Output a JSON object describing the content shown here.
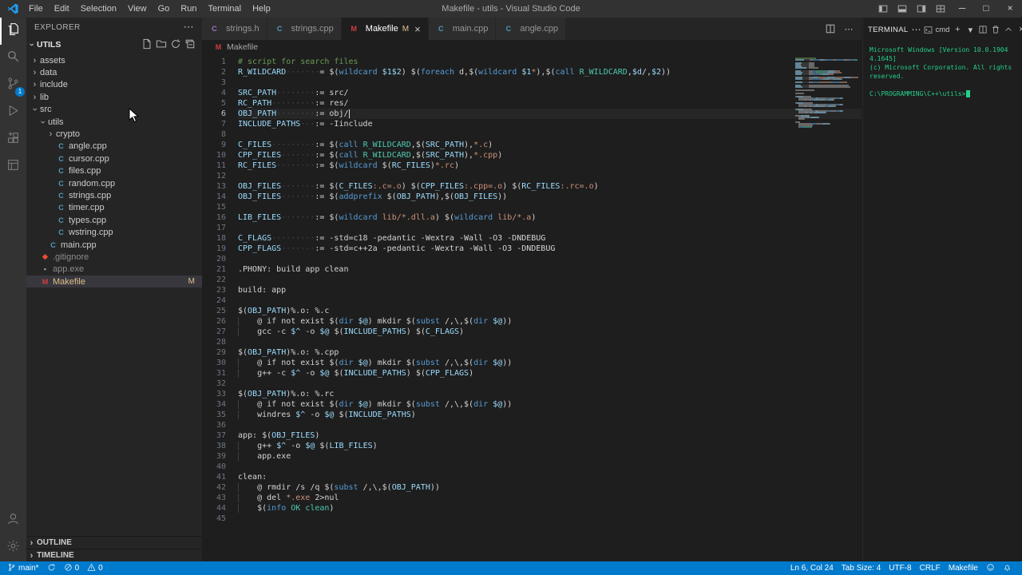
{
  "window": {
    "title": "Makefile - utils - Visual Studio Code",
    "menus": [
      "File",
      "Edit",
      "Selection",
      "View",
      "Go",
      "Run",
      "Terminal",
      "Help"
    ],
    "layout_icons": [
      "layout-sidebar",
      "layout-panel",
      "layout-sidebar-right",
      "layout-customize"
    ],
    "controls": {
      "minimize": "─",
      "maximize": "□",
      "close": "×"
    }
  },
  "activity_bar": {
    "items": [
      {
        "name": "explorer",
        "active": true
      },
      {
        "name": "search"
      },
      {
        "name": "source-control",
        "badge": "1"
      },
      {
        "name": "run-debug"
      },
      {
        "name": "extensions"
      },
      {
        "name": "remote-window"
      }
    ],
    "bottom": [
      {
        "name": "account"
      },
      {
        "name": "settings"
      }
    ]
  },
  "sidebar": {
    "header": "EXPLORER",
    "more": "⋯",
    "section": "UTILS",
    "section_actions": [
      "new-file",
      "new-folder",
      "refresh",
      "collapse-all"
    ],
    "tree": [
      {
        "label": "assets",
        "level": 0,
        "kind": "folder"
      },
      {
        "label": "data",
        "level": 0,
        "kind": "folder"
      },
      {
        "label": "include",
        "level": 0,
        "kind": "folder"
      },
      {
        "label": "lib",
        "level": 0,
        "kind": "folder"
      },
      {
        "label": "src",
        "level": 0,
        "kind": "folder",
        "expanded": true
      },
      {
        "label": "utils",
        "level": 1,
        "kind": "folder",
        "expanded": true
      },
      {
        "label": "crypto",
        "level": 2,
        "kind": "folder"
      },
      {
        "label": "angle.cpp",
        "level": 2,
        "kind": "file",
        "icon": "cpp"
      },
      {
        "label": "cursor.cpp",
        "level": 2,
        "kind": "file",
        "icon": "cpp"
      },
      {
        "label": "files.cpp",
        "level": 2,
        "kind": "file",
        "icon": "cpp"
      },
      {
        "label": "random.cpp",
        "level": 2,
        "kind": "file",
        "icon": "cpp"
      },
      {
        "label": "strings.cpp",
        "level": 2,
        "kind": "file",
        "icon": "cpp"
      },
      {
        "label": "timer.cpp",
        "level": 2,
        "kind": "file",
        "icon": "cpp"
      },
      {
        "label": "types.cpp",
        "level": 2,
        "kind": "file",
        "icon": "cpp"
      },
      {
        "label": "wstring.cpp",
        "level": 2,
        "kind": "file",
        "icon": "cpp"
      },
      {
        "label": "main.cpp",
        "level": 1,
        "kind": "file",
        "icon": "cpp"
      },
      {
        "label": ".gitignore",
        "level": 0,
        "kind": "file",
        "icon": "git",
        "dim": true
      },
      {
        "label": "app.exe",
        "level": 0,
        "kind": "file",
        "icon": "exe",
        "dim": true
      },
      {
        "label": "Makefile",
        "level": 0,
        "kind": "file",
        "icon": "make",
        "selected": true,
        "modified": true,
        "badge": "M"
      }
    ],
    "bottom_sections": [
      {
        "label": "OUTLINE"
      },
      {
        "label": "TIMELINE"
      }
    ]
  },
  "file_icons": {
    "cpp": {
      "glyph": "C",
      "color": "#519aba"
    },
    "h": {
      "glyph": "C",
      "color": "#a074c4"
    },
    "git": {
      "glyph": "◆",
      "color": "#e84d31"
    },
    "exe": {
      "glyph": "▪",
      "color": "#9e9e9e"
    },
    "make": {
      "glyph": "M",
      "color": "#cc3e44"
    }
  },
  "editor": {
    "tabs": [
      {
        "label": "strings.h",
        "icon": "h"
      },
      {
        "label": "strings.cpp",
        "icon": "cpp"
      },
      {
        "label": "Makefile",
        "icon": "make",
        "active": true,
        "badge": "M",
        "close": "×"
      },
      {
        "label": "main.cpp",
        "icon": "cpp"
      },
      {
        "label": "angle.cpp",
        "icon": "cpp"
      }
    ],
    "tab_actions": [
      "split-editor",
      "more"
    ],
    "breadcrumb": {
      "icon": "make",
      "label": "Makefile"
    },
    "cursor": {
      "line": 6,
      "col": 24
    },
    "lines": [
      [
        [
          "cm",
          "# script for search files"
        ]
      ],
      [
        [
          "vr",
          "R_WILDCARD"
        ],
        [
          "ws",
          "·······"
        ],
        [
          "pl",
          "= $("
        ],
        [
          "fn",
          "wildcard"
        ],
        [
          "pl",
          " "
        ],
        [
          "vr",
          "$1$2"
        ],
        [
          "pl",
          ") $("
        ],
        [
          "fn",
          "foreach"
        ],
        [
          "pl",
          " d,$("
        ],
        [
          "fn",
          "wildcard"
        ],
        [
          "pl",
          " "
        ],
        [
          "vr",
          "$1"
        ],
        [
          "st",
          "*"
        ],
        [
          "pl",
          "),$("
        ],
        [
          "fn",
          "call"
        ],
        [
          "pl",
          " "
        ],
        [
          "tl",
          "R_WILDCARD"
        ],
        [
          "pl",
          ","
        ],
        [
          "vr",
          "$d"
        ],
        [
          "pl",
          "/,"
        ],
        [
          "vr",
          "$2"
        ],
        [
          "pl",
          "))"
        ]
      ],
      [],
      [
        [
          "vr",
          "SRC_PATH"
        ],
        [
          "ws",
          "········"
        ],
        [
          "pl",
          ":= src/"
        ]
      ],
      [
        [
          "vr",
          "RC_PATH"
        ],
        [
          "ws",
          "·········"
        ],
        [
          "pl",
          ":= res/"
        ]
      ],
      [
        [
          "vr",
          "OBJ_PATH"
        ],
        [
          "ws",
          "········"
        ],
        [
          "pl",
          ":= obj/"
        ],
        [
          "cur",
          ""
        ]
      ],
      [
        [
          "vr",
          "INCLUDE_PATHS"
        ],
        [
          "ws",
          "···"
        ],
        [
          "pl",
          ":= -Iinclude"
        ]
      ],
      [],
      [
        [
          "vr",
          "C_FILES"
        ],
        [
          "ws",
          "·········"
        ],
        [
          "pl",
          ":= $("
        ],
        [
          "fn",
          "call"
        ],
        [
          "pl",
          " "
        ],
        [
          "tl",
          "R_WILDCARD"
        ],
        [
          "pl",
          ",$("
        ],
        [
          "vr",
          "SRC_PATH"
        ],
        [
          "pl",
          "),"
        ],
        [
          "st",
          "*.c"
        ],
        [
          "pl",
          ")"
        ]
      ],
      [
        [
          "vr",
          "CPP_FILES"
        ],
        [
          "ws",
          "·······"
        ],
        [
          "pl",
          ":= $("
        ],
        [
          "fn",
          "call"
        ],
        [
          "pl",
          " "
        ],
        [
          "tl",
          "R_WILDCARD"
        ],
        [
          "pl",
          ",$("
        ],
        [
          "vr",
          "SRC_PATH"
        ],
        [
          "pl",
          "),"
        ],
        [
          "st",
          "*.cpp"
        ],
        [
          "pl",
          ")"
        ]
      ],
      [
        [
          "vr",
          "RC_FILES"
        ],
        [
          "ws",
          "········"
        ],
        [
          "pl",
          ":= $("
        ],
        [
          "fn",
          "wildcard"
        ],
        [
          "pl",
          " $("
        ],
        [
          "vr",
          "RC_FILES"
        ],
        [
          "pl",
          ")"
        ],
        [
          "st",
          "*.rc"
        ],
        [
          "pl",
          ")"
        ]
      ],
      [],
      [
        [
          "vr",
          "OBJ_FILES"
        ],
        [
          "ws",
          "·······"
        ],
        [
          "pl",
          ":= $("
        ],
        [
          "vr",
          "C_FILES"
        ],
        [
          "st",
          ":.c=.o"
        ],
        [
          "pl",
          ") $("
        ],
        [
          "vr",
          "CPP_FILES"
        ],
        [
          "st",
          ":.cpp=.o"
        ],
        [
          "pl",
          ") $("
        ],
        [
          "vr",
          "RC_FILES"
        ],
        [
          "st",
          ":.rc=.o"
        ],
        [
          "pl",
          ")"
        ]
      ],
      [
        [
          "vr",
          "OBJ_FILES"
        ],
        [
          "ws",
          "·······"
        ],
        [
          "pl",
          ":= $("
        ],
        [
          "fn",
          "addprefix"
        ],
        [
          "pl",
          " $("
        ],
        [
          "vr",
          "OBJ_PATH"
        ],
        [
          "pl",
          "),$("
        ],
        [
          "vr",
          "OBJ_FILES"
        ],
        [
          "pl",
          "))"
        ]
      ],
      [],
      [
        [
          "vr",
          "LIB_FILES"
        ],
        [
          "ws",
          "·······"
        ],
        [
          "pl",
          ":= $("
        ],
        [
          "fn",
          "wildcard"
        ],
        [
          "pl",
          " "
        ],
        [
          "st",
          "lib/*.dll.a"
        ],
        [
          "pl",
          ") $("
        ],
        [
          "fn",
          "wildcard"
        ],
        [
          "pl",
          " "
        ],
        [
          "st",
          "lib/*.a"
        ],
        [
          "pl",
          ")"
        ]
      ],
      [],
      [
        [
          "vr",
          "C_FLAGS"
        ],
        [
          "ws",
          "·········"
        ],
        [
          "pl",
          ":= -std=c18 -pedantic -Wextra -Wall -O3 -DNDEBUG"
        ]
      ],
      [
        [
          "vr",
          "CPP_FLAGS"
        ],
        [
          "ws",
          "·······"
        ],
        [
          "pl",
          ":= -std=c++2a -pedantic -Wextra -Wall -O3 -DNDEBUG"
        ]
      ],
      [],
      [
        [
          "pl",
          ".PHONY: build app clean"
        ]
      ],
      [],
      [
        [
          "pl",
          "build: app"
        ]
      ],
      [],
      [
        [
          "pl",
          "$("
        ],
        [
          "vr",
          "OBJ_PATH"
        ],
        [
          "pl",
          ")%.o: %.c"
        ]
      ],
      [
        [
          "ig",
          "    "
        ],
        [
          "pl",
          "@ if not exist $("
        ],
        [
          "fn",
          "dir"
        ],
        [
          "pl",
          " "
        ],
        [
          "vr",
          "$@"
        ],
        [
          "pl",
          ") mkdir $("
        ],
        [
          "fn",
          "subst"
        ],
        [
          "pl",
          " /,\\,$("
        ],
        [
          "fn",
          "dir"
        ],
        [
          "pl",
          " "
        ],
        [
          "vr",
          "$@"
        ],
        [
          "pl",
          "))"
        ]
      ],
      [
        [
          "ig",
          "    "
        ],
        [
          "pl",
          "gcc -c "
        ],
        [
          "vr",
          "$^"
        ],
        [
          "pl",
          " -o "
        ],
        [
          "vr",
          "$@"
        ],
        [
          "pl",
          " $("
        ],
        [
          "vr",
          "INCLUDE_PATHS"
        ],
        [
          "pl",
          ") $("
        ],
        [
          "vr",
          "C_FLAGS"
        ],
        [
          "pl",
          ")"
        ]
      ],
      [],
      [
        [
          "pl",
          "$("
        ],
        [
          "vr",
          "OBJ_PATH"
        ],
        [
          "pl",
          ")%.o: %.cpp"
        ]
      ],
      [
        [
          "ig",
          "    "
        ],
        [
          "pl",
          "@ if not exist $("
        ],
        [
          "fn",
          "dir"
        ],
        [
          "pl",
          " "
        ],
        [
          "vr",
          "$@"
        ],
        [
          "pl",
          ") mkdir $("
        ],
        [
          "fn",
          "subst"
        ],
        [
          "pl",
          " /,\\,$("
        ],
        [
          "fn",
          "dir"
        ],
        [
          "pl",
          " "
        ],
        [
          "vr",
          "$@"
        ],
        [
          "pl",
          "))"
        ]
      ],
      [
        [
          "ig",
          "    "
        ],
        [
          "pl",
          "g++ -c "
        ],
        [
          "vr",
          "$^"
        ],
        [
          "pl",
          " -o "
        ],
        [
          "vr",
          "$@"
        ],
        [
          "pl",
          " $("
        ],
        [
          "vr",
          "INCLUDE_PATHS"
        ],
        [
          "pl",
          ") $("
        ],
        [
          "vr",
          "CPP_FLAGS"
        ],
        [
          "pl",
          ")"
        ]
      ],
      [],
      [
        [
          "pl",
          "$("
        ],
        [
          "vr",
          "OBJ_PATH"
        ],
        [
          "pl",
          ")%.o: %.rc"
        ]
      ],
      [
        [
          "ig",
          "    "
        ],
        [
          "pl",
          "@ if not exist $("
        ],
        [
          "fn",
          "dir"
        ],
        [
          "pl",
          " "
        ],
        [
          "vr",
          "$@"
        ],
        [
          "pl",
          ") mkdir $("
        ],
        [
          "fn",
          "subst"
        ],
        [
          "pl",
          " /,\\,$("
        ],
        [
          "fn",
          "dir"
        ],
        [
          "pl",
          " "
        ],
        [
          "vr",
          "$@"
        ],
        [
          "pl",
          "))"
        ]
      ],
      [
        [
          "ig",
          "    "
        ],
        [
          "pl",
          "windres "
        ],
        [
          "vr",
          "$^"
        ],
        [
          "pl",
          " -o "
        ],
        [
          "vr",
          "$@"
        ],
        [
          "pl",
          " $("
        ],
        [
          "vr",
          "INCLUDE_PATHS"
        ],
        [
          "pl",
          ")"
        ]
      ],
      [],
      [
        [
          "pl",
          "app: $("
        ],
        [
          "vr",
          "OBJ_FILES"
        ],
        [
          "pl",
          ")"
        ]
      ],
      [
        [
          "ig",
          "    "
        ],
        [
          "pl",
          "g++ "
        ],
        [
          "vr",
          "$^"
        ],
        [
          "pl",
          " -o "
        ],
        [
          "vr",
          "$@"
        ],
        [
          "pl",
          " $("
        ],
        [
          "vr",
          "LIB_FILES"
        ],
        [
          "pl",
          ")"
        ]
      ],
      [
        [
          "ig",
          "    "
        ],
        [
          "pl",
          "app.exe"
        ]
      ],
      [],
      [
        [
          "pl",
          "clean:"
        ]
      ],
      [
        [
          "ig",
          "    "
        ],
        [
          "pl",
          "@ rmdir /s /q $("
        ],
        [
          "fn",
          "subst"
        ],
        [
          "pl",
          " /,\\,$("
        ],
        [
          "vr",
          "OBJ_PATH"
        ],
        [
          "pl",
          "))"
        ]
      ],
      [
        [
          "ig",
          "    "
        ],
        [
          "pl",
          "@ del "
        ],
        [
          "st",
          "*.exe"
        ],
        [
          "pl",
          " 2>nul"
        ]
      ],
      [
        [
          "ig",
          "    "
        ],
        [
          "pl",
          "$("
        ],
        [
          "fn",
          "info"
        ],
        [
          "tl",
          " OK clean"
        ],
        [
          "pl",
          ")"
        ]
      ],
      []
    ]
  },
  "terminal": {
    "title": "TERMINAL",
    "more": "⋯",
    "shell_label": "cmd",
    "actions": [
      "plus",
      "dropdown",
      "split-terminal",
      "trash",
      "chevron-up",
      "close-x"
    ],
    "text_color": "#23d18b",
    "output": [
      "Microsoft Windows [Version 10.0.19044.1645]",
      "(c) Microsoft Corporation. All rights reserved.",
      ""
    ],
    "prompt": "C:\\PROGRAMMING\\C++\\utils>"
  },
  "status_bar": {
    "accent": "#007acc",
    "left": [
      {
        "icon": "branch",
        "label": "main*"
      },
      {
        "icon": "sync",
        "label": ""
      },
      {
        "icon": "error",
        "label": "0"
      },
      {
        "icon": "warning",
        "label": "0"
      }
    ],
    "right": [
      {
        "label": "Ln 6, Col 24"
      },
      {
        "label": "Tab Size: 4"
      },
      {
        "label": "UTF-8"
      },
      {
        "label": "CRLF"
      },
      {
        "label": "Makefile"
      },
      {
        "icon": "feedback",
        "label": ""
      },
      {
        "icon": "bell",
        "label": ""
      }
    ]
  }
}
